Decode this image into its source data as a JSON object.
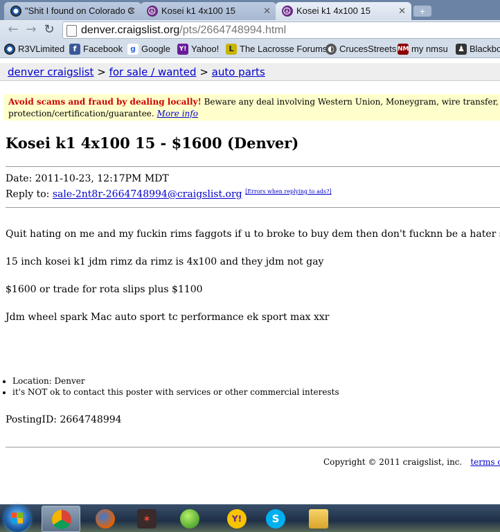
{
  "browser": {
    "tabs": [
      {
        "title": "\"Shit I found on Colorado C",
        "icon": "bmw-favicon-icon"
      },
      {
        "title": "Kosei k1 4x100 15",
        "icon": "craigslist-peace-icon"
      },
      {
        "title": "Kosei k1 4x100 15",
        "icon": "craigslist-peace-icon"
      }
    ],
    "url_host": "denver.craigslist.org",
    "url_path": "/pts/2664748994.html",
    "bookmarks": [
      {
        "label": "R3VLimited",
        "icon": "bmw-icon"
      },
      {
        "label": "Facebook",
        "icon": "facebook-icon"
      },
      {
        "label": "Google",
        "icon": "google-icon"
      },
      {
        "label": "Yahoo!",
        "icon": "yahoo-icon"
      },
      {
        "label": "The Lacrosse Forums",
        "icon": "lacrosse-forums-icon"
      },
      {
        "label": "CrucesStreets",
        "icon": "crucesstreets-icon"
      },
      {
        "label": "my nmsu",
        "icon": "nmsu-icon"
      },
      {
        "label": "Blackboa",
        "icon": "blackboard-icon"
      }
    ]
  },
  "page": {
    "breadcrumb": {
      "site": "denver craigslist",
      "sep1": " > ",
      "section": "for sale / wanted",
      "sep2": " > ",
      "category": "auto parts"
    },
    "scam_bold": "Avoid scams and fraud by dealing locally!",
    "scam_text1": " Beware any deal involving Western Union, Moneygram, wire transfer, cashier check, money order, shipping, escrow, or any promise of transaction",
    "scam_text2": "protection/certification/guarantee. ",
    "scam_link": "More info",
    "title": "Kosei k1 4x100 15 - $1600 (Denver)",
    "date": "Date: 2011-10-23, 12:17PM MDT",
    "reply_label": "Reply to: ",
    "reply_email": "sale-2nt8r-2664748994@craigslist.org",
    "reply_errors": "[Errors when replying to ads?]",
    "body": [
      "Quit hating on me and my fuckin rims faggots if u to broke to buy dem then don't fucknn be a hater stupid ass crackas",
      "15 inch kosei k1 jdm rimz da rimz is 4x100 and they jdm not gay",
      "$1600 or trade for rota slips plus $1100",
      "Jdm wheel spark Mac auto sport tc performance ek sport max xxr"
    ],
    "blurbs": [
      "Location: Denver",
      "it's NOT ok to contact this poster with services or other commercial interests"
    ],
    "posting_id": "PostingID: 2664748994",
    "copyright": "Copyright © 2011 craigslist, inc.",
    "terms": "terms of use"
  },
  "taskbar": {
    "items": [
      "chrome-icon",
      "firefox-icon",
      "app-icon",
      "windows-live-icon",
      "yahoo-messenger-icon",
      "skype-icon",
      "explorer-icon"
    ]
  }
}
